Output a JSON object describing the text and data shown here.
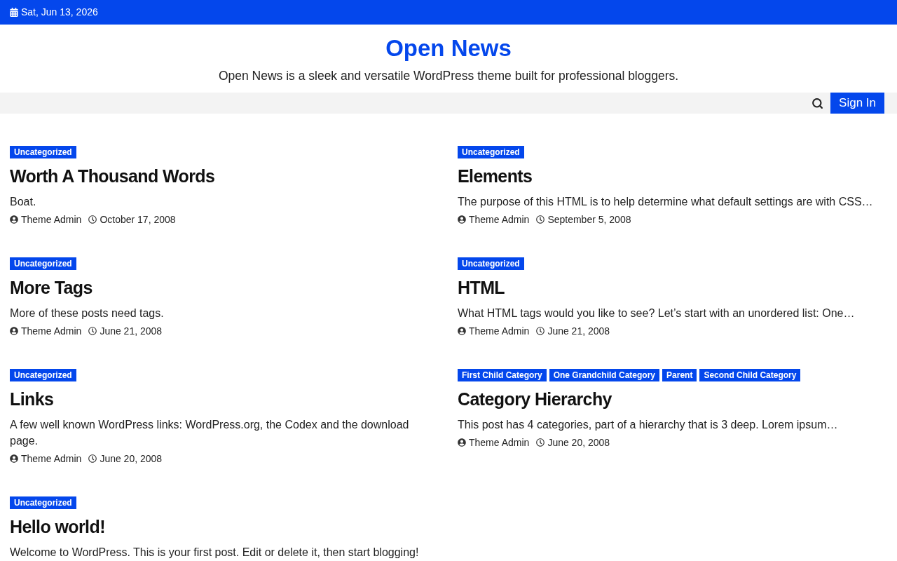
{
  "top_bar": {
    "date": "Sat, Jun 13, 2026"
  },
  "header": {
    "site_title": "Open News",
    "tagline": "Open News is a sleek and versatile WordPress theme built for professional bloggers."
  },
  "nav": {
    "sign_in": "Sign In"
  },
  "posts": [
    {
      "categories": [
        "Uncategorized"
      ],
      "title": "Worth A Thousand Words",
      "excerpt": "Boat.",
      "author": "Theme Admin",
      "date": "October 17, 2008"
    },
    {
      "categories": [
        "Uncategorized"
      ],
      "title": "Elements",
      "excerpt": "The purpose of this HTML is to help determine what default settings are with CSS…",
      "author": "Theme Admin",
      "date": "September 5, 2008"
    },
    {
      "categories": [
        "Uncategorized"
      ],
      "title": "More Tags",
      "excerpt": "More of these posts need tags.",
      "author": "Theme Admin",
      "date": "June 21, 2008"
    },
    {
      "categories": [
        "Uncategorized"
      ],
      "title": "HTML",
      "excerpt": "What HTML tags would you like to see? Let’s start with an unordered list: One…",
      "author": "Theme Admin",
      "date": "June 21, 2008"
    },
    {
      "categories": [
        "Uncategorized"
      ],
      "title": "Links",
      "excerpt": "A few well known WordPress links: WordPress.org, the Codex and the download page.",
      "author": "Theme Admin",
      "date": "June 20, 2008"
    },
    {
      "categories": [
        "First Child Category",
        "One Grandchild Category",
        "Parent",
        "Second Child Category"
      ],
      "title": "Category Hierarchy",
      "excerpt": "This post has 4 categories, part of a hierarchy that is 3 deep. Lorem ipsum…",
      "author": "Theme Admin",
      "date": "June 20, 2008"
    },
    {
      "categories": [
        "Uncategorized"
      ],
      "title": "Hello world!",
      "excerpt": "Welcome to WordPress. This is your first post. Edit or delete it, then start blogging!"
    }
  ]
}
